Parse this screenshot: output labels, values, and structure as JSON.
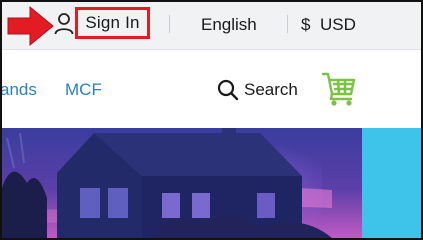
{
  "header": {
    "sign_in": "Sign In",
    "language": "English",
    "currency_symbol": "$",
    "currency": "USD"
  },
  "nav": {
    "links": [
      "ands",
      "MCF"
    ],
    "search_label": "Search"
  },
  "icons": {
    "pointer": "arrow-right-icon",
    "user": "user-icon",
    "search": "search-icon",
    "cart": "cart-icon"
  },
  "colors": {
    "highlight": "#e31b23",
    "link": "#2a82c2",
    "cart": "#7cc242",
    "topbar_bg": "#f1f2f4",
    "hero_accent": "#3ec3ea"
  }
}
